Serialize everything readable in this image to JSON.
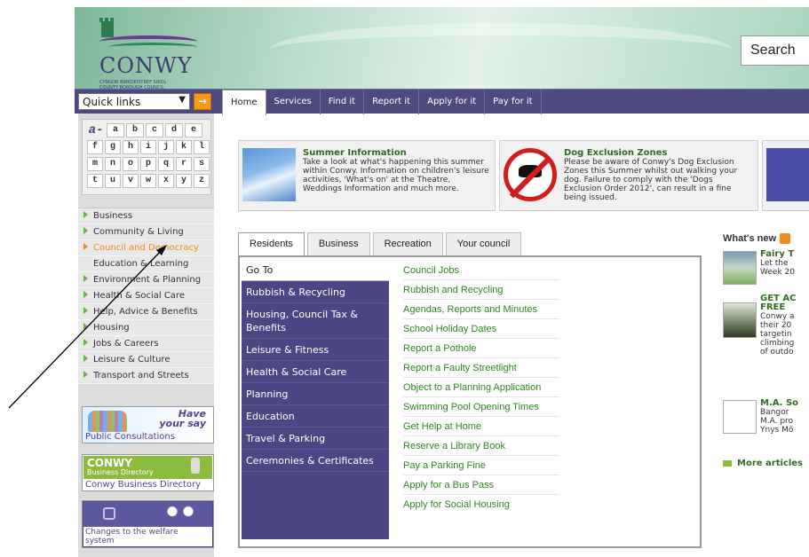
{
  "header": {
    "logo_name": "CONWY",
    "logo_sub_1": "CYNGOR BWRDEISTREF SIROL",
    "logo_sub_2": "COUNTY BOROUGH COUNCIL",
    "search_label": "Search"
  },
  "navbar": {
    "quick_links": "Quick links",
    "go_symbol": "→",
    "tabs": [
      "Home",
      "Services",
      "Find it",
      "Report it",
      "Apply for it",
      "Pay for it"
    ]
  },
  "az": {
    "logo": "a-z",
    "rows": [
      [
        "",
        "a",
        "b",
        "c",
        "d",
        "e"
      ],
      [
        "f",
        "g",
        "h",
        "i",
        "j",
        "k",
        "l"
      ],
      [
        "m",
        "n",
        "o",
        "p",
        "q",
        "r",
        "s"
      ],
      [
        "t",
        "u",
        "v",
        "w",
        "x",
        "y",
        "z"
      ]
    ]
  },
  "sidebar": {
    "items": [
      "Business",
      "Community & Living",
      "Council and Democracy",
      "Education & Learning",
      "Environment & Planning",
      "Health & Social Care",
      "Help, Advice & Benefits",
      "Housing",
      "Jobs & Careers",
      "Leisure & Culture",
      "Transport and Streets"
    ],
    "active_index": 2
  },
  "promos": {
    "consult_title_1": "Have",
    "consult_title_2": "your say",
    "consult_caption": "Public Consultations",
    "bizdir_title": "CONWY",
    "bizdir_sub": "Business Directory",
    "bizdir_caption": "Conwy Business Directory",
    "welfare_caption_1": "Changes to the welfare",
    "welfare_caption_2": "system"
  },
  "features": [
    {
      "title": "Summer Information",
      "text": "Take a look at what's happening this summer within Conwy. Information on children's leisure activities, 'What's on' at the Theatre, Weddings Information and much more."
    },
    {
      "title": "Dog Exclusion Zones",
      "text": "Please be aware of Conwy's Dog Exclusion Zones this Summer whilst out walking your dog. Failure to comply with the 'Dogs Exclusion Order 2012', can result in a fine being issued."
    }
  ],
  "section_tabs": [
    "Residents",
    "Business",
    "Recreation",
    "Your council"
  ],
  "go_to": {
    "heading": "Go To",
    "items": [
      "Rubbish & Recycling",
      "Housing, Council Tax & Benefits",
      "Leisure & Fitness",
      "Health & Social Care",
      "Planning",
      "Education",
      "Travel & Parking",
      "Ceremonies & Certificates"
    ]
  },
  "links": [
    "Council Jobs",
    "Rubbish and Recycling",
    "Agendas, Reports and Minutes",
    "School Holiday Dates",
    "Report a Pothole",
    "Report a Faulty Streetlight",
    "Object to a Planning Application",
    "Swimming Pool Opening Times",
    "Get Help at Home",
    "Reserve a Library Book",
    "Pay a Parking Fine",
    "Apply for a Bus Pass",
    "Apply for Social Housing"
  ],
  "whats_new": {
    "heading": "What's new",
    "news": [
      {
        "title": "Fairy T",
        "lines": [
          "Let the",
          "Week 20"
        ]
      },
      {
        "title": "GET AC",
        "title2": "FREE",
        "lines": [
          "Conwy a",
          "their 20",
          "targetin",
          "climbing",
          "of outdo"
        ]
      },
      {
        "title": "M.A. So",
        "lines": [
          "Bangor",
          "M.A. pro",
          "Ynys Mô"
        ]
      }
    ],
    "more": "More articles"
  },
  "colors": {
    "nav_purple": "#4d4a7d",
    "link_green": "#2f8521",
    "active_orange": "#f08c1a"
  }
}
